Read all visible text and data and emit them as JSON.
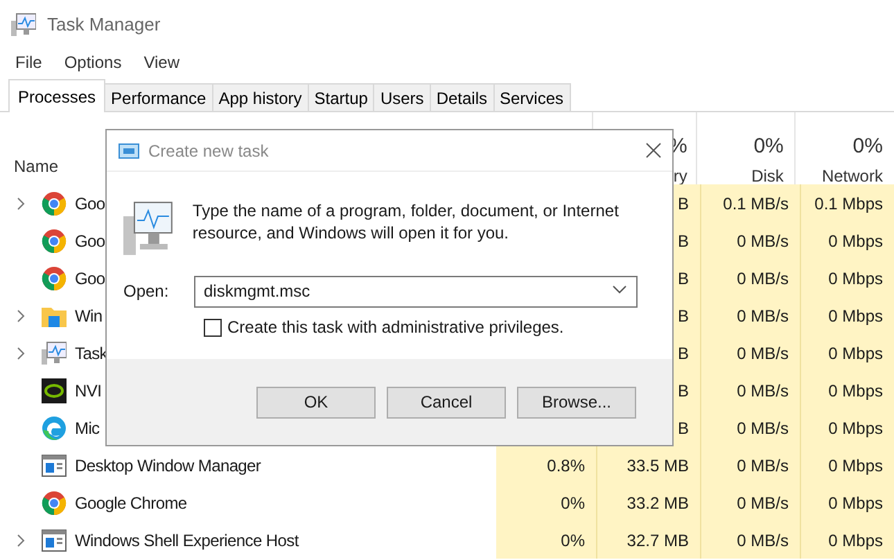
{
  "window": {
    "title": "Task Manager"
  },
  "menu": [
    "File",
    "Options",
    "View"
  ],
  "tabs": [
    {
      "label": "Processes",
      "selected": true
    },
    {
      "label": "Performance",
      "selected": false
    },
    {
      "label": "App history",
      "selected": false
    },
    {
      "label": "Startup",
      "selected": false
    },
    {
      "label": "Users",
      "selected": false
    },
    {
      "label": "Details",
      "selected": false
    },
    {
      "label": "Services",
      "selected": false
    }
  ],
  "columns": {
    "name": "Name",
    "memory": {
      "value": "%",
      "label": "ry"
    },
    "disk": {
      "value": "0%",
      "label": "Disk"
    },
    "network": {
      "value": "0%",
      "label": "Network"
    }
  },
  "rows": [
    {
      "kind": "browser",
      "expandable": true,
      "name": "Goo",
      "memory": "B",
      "disk": "0.1 MB/s",
      "network": "0.1 Mbps"
    },
    {
      "kind": "browser",
      "expandable": false,
      "name": "Goo",
      "memory": "B",
      "disk": "0 MB/s",
      "network": "0 Mbps"
    },
    {
      "kind": "browser",
      "expandable": false,
      "name": "Goo",
      "memory": "B",
      "disk": "0 MB/s",
      "network": "0 Mbps"
    },
    {
      "kind": "folder",
      "expandable": true,
      "name": "Win",
      "memory": "B",
      "disk": "0 MB/s",
      "network": "0 Mbps"
    },
    {
      "kind": "monitor",
      "expandable": true,
      "name": "Task",
      "memory": "B",
      "disk": "0 MB/s",
      "network": "0 Mbps"
    },
    {
      "kind": "gpu",
      "expandable": false,
      "name": "NVI",
      "memory": "B",
      "disk": "0 MB/s",
      "network": "0 Mbps"
    },
    {
      "kind": "edge",
      "expandable": false,
      "name": "Mic",
      "memory": "B",
      "disk": "0 MB/s",
      "network": "0 Mbps"
    },
    {
      "kind": "window",
      "expandable": false,
      "name": "Desktop Window Manager",
      "cpu": "0.8%",
      "memory": "33.5 MB",
      "disk": "0 MB/s",
      "network": "0 Mbps"
    },
    {
      "kind": "browser",
      "expandable": false,
      "name": "Google Chrome",
      "cpu": "0%",
      "memory": "33.2 MB",
      "disk": "0 MB/s",
      "network": "0 Mbps"
    },
    {
      "kind": "window",
      "expandable": true,
      "name": "Windows Shell Experience Host",
      "cpu": "0%",
      "memory": "32.7 MB",
      "disk": "0 MB/s",
      "network": "0 Mbps"
    }
  ],
  "dialog": {
    "title": "Create new task",
    "message": "Type the name of a program, folder, document, or Internet resource, and Windows will open it for you.",
    "open_label": "Open:",
    "open_value": "diskmgmt.msc",
    "admin_checkbox": {
      "label": "Create this task with administrative privileges.",
      "checked": false
    },
    "buttons": [
      "OK",
      "Cancel",
      "Browse..."
    ]
  }
}
